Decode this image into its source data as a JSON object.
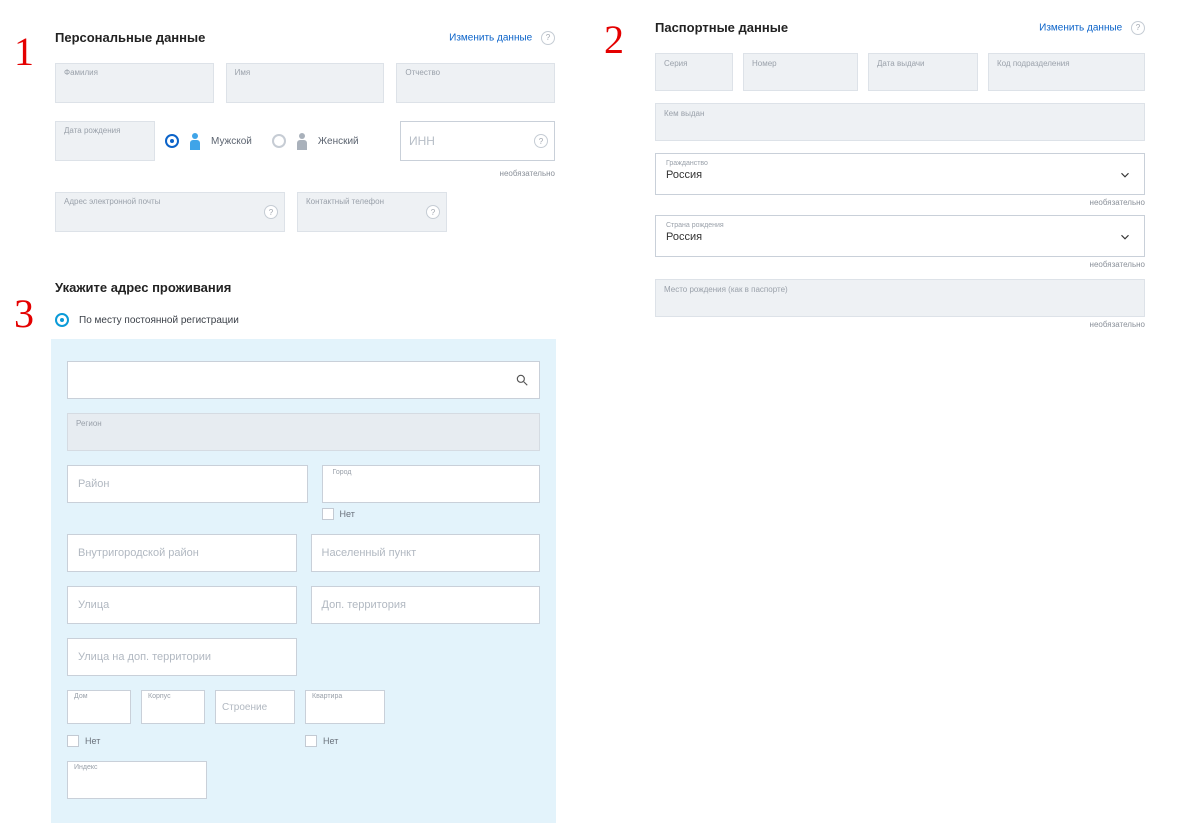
{
  "numbers": {
    "n1": "1",
    "n2": "2",
    "n3": "3"
  },
  "personal": {
    "title": "Персональные данные",
    "change": "Изменить данные",
    "fields": {
      "surname": "Фамилия",
      "name": "Имя",
      "patronymic": "Отчество",
      "dob": "Дата рождения",
      "email": "Адрес электронной почты",
      "phone": "Контактный телефон"
    },
    "gender": {
      "male": "Мужской",
      "female": "Женский"
    },
    "inn": {
      "placeholder": "ИНН",
      "optional": "необязательно"
    }
  },
  "address": {
    "title": "Укажите адрес проживания",
    "radio": "По месту постоянной регистрации",
    "region": "Регион",
    "district": "Район",
    "city_label": "Город",
    "city_no": "Нет",
    "inner_district": "Внутригородской район",
    "settlement": "Населенный пункт",
    "street": "Улица",
    "extra_territory": "Доп. территория",
    "street_extra": "Улица на доп. территории",
    "house": "Дом",
    "korpus": "Корпус",
    "building": "Строение",
    "flat": "Квартира",
    "house_no": "Нет",
    "flat_no": "Нет",
    "index": "Индекс"
  },
  "passport": {
    "title": "Паспортные данные",
    "change": "Изменить данные",
    "series": "Серия",
    "number": "Номер",
    "date": "Дата выдачи",
    "unit": "Код подразделения",
    "issued_by": "Кем выдан",
    "citizenship_label": "Гражданство",
    "citizenship_value": "Россия",
    "birth_country_label": "Страна рождения",
    "birth_country_value": "Россия",
    "birth_place": "Место рождения (как в паспорте)",
    "optional": "необязательно"
  }
}
